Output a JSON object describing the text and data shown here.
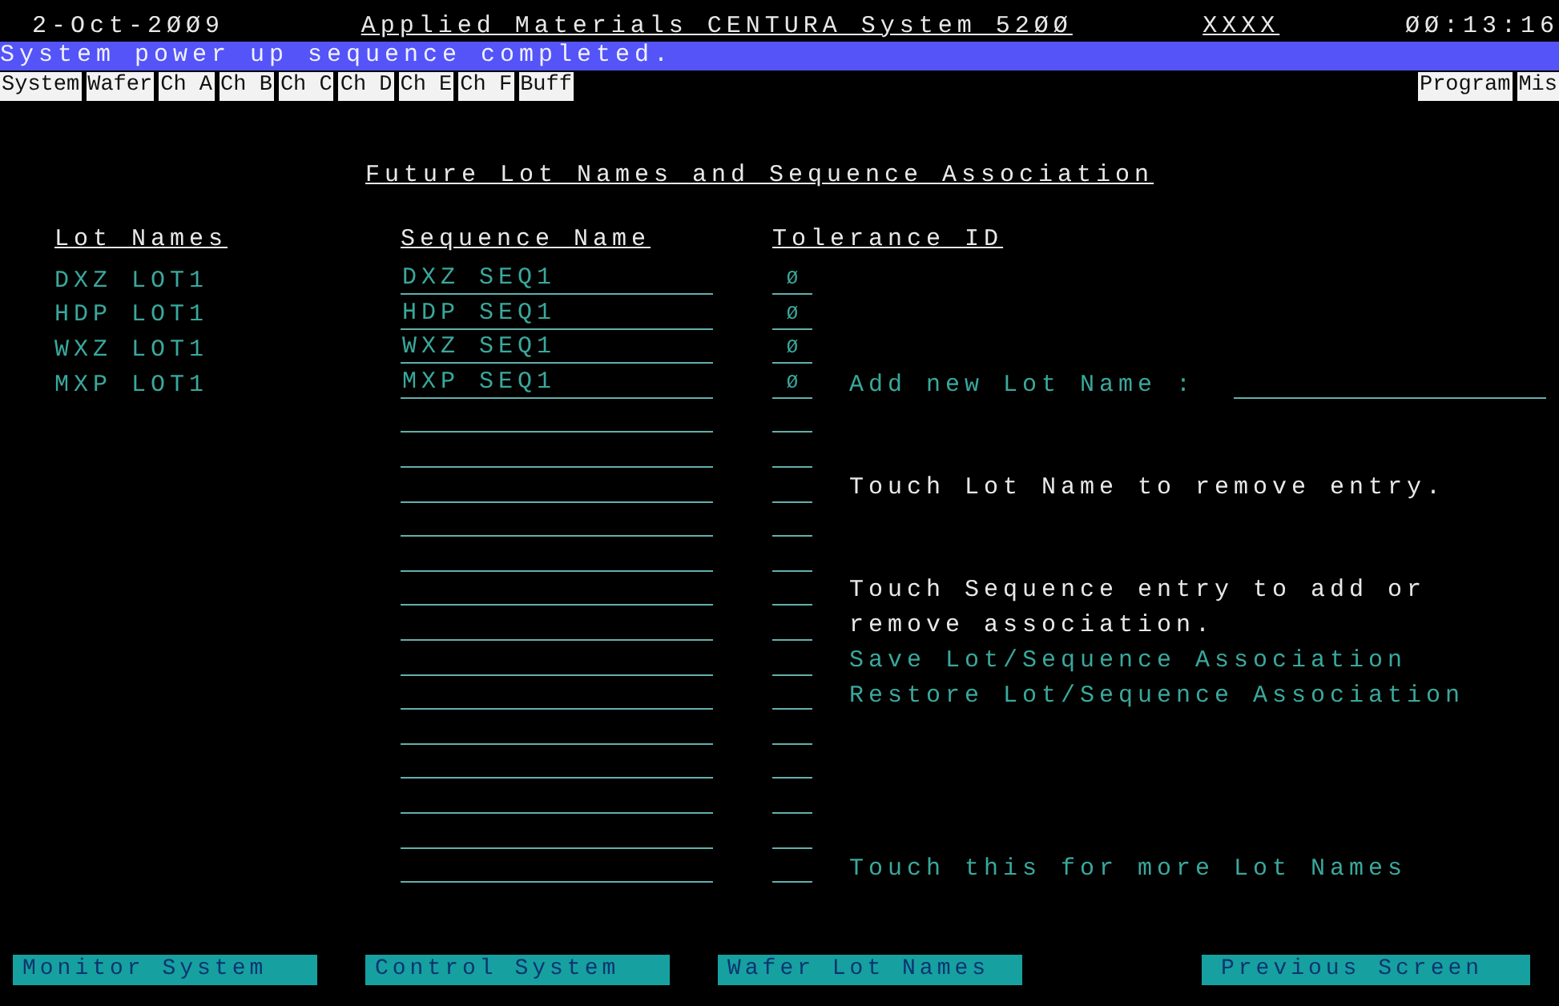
{
  "header": {
    "date": "2-Oct-2ØØ9",
    "title": "Applied Materials CENTURA System",
    "model": "52ØØ",
    "user": "XXXX",
    "time": "ØØ:13:16"
  },
  "message": "System power up sequence completed.",
  "nav_tabs": {
    "left": [
      "System",
      "Wafer",
      "Ch A",
      "Ch B",
      "Ch C",
      "Ch D",
      "Ch E",
      "Ch F",
      "Buff"
    ],
    "right": [
      "Program",
      "Mis"
    ]
  },
  "page_title": "Future Lot Names and Sequence Association",
  "columns": [
    "Lot Names",
    "Sequence Name",
    "Tolerance ID"
  ],
  "rows": [
    {
      "kind": "entry",
      "lot": "DXZ LOT1",
      "sequence": "DXZ SEQ1",
      "tolerance": "Ø"
    },
    {
      "kind": "entry",
      "lot": "HDP LOT1",
      "sequence": "HDP SEQ1",
      "tolerance": "Ø"
    },
    {
      "kind": "entry",
      "lot": "WXZ LOT1",
      "sequence": "WXZ SEQ1",
      "tolerance": "Ø"
    },
    {
      "kind": "entry",
      "lot": "MXP LOT1",
      "sequence": "MXP SEQ1",
      "tolerance": "Ø"
    },
    {
      "kind": "blank"
    },
    {
      "kind": "blank"
    },
    {
      "kind": "blank"
    },
    {
      "kind": "blank"
    },
    {
      "kind": "blank"
    },
    {
      "kind": "blank"
    },
    {
      "kind": "blank"
    },
    {
      "kind": "blank"
    },
    {
      "kind": "blank"
    },
    {
      "kind": "blank"
    },
    {
      "kind": "blank"
    },
    {
      "kind": "blank"
    },
    {
      "kind": "blank"
    },
    {
      "kind": "blank"
    }
  ],
  "add_lot": {
    "label": "Add new Lot Name :"
  },
  "instructions": [
    {
      "kind": "note",
      "text": "Touch Lot Name to remove entry."
    },
    {
      "kind": "note",
      "text": "Touch Sequence entry to add or remove association."
    },
    {
      "kind": "action",
      "text": "Save Lot/Sequence Association"
    },
    {
      "kind": "action",
      "text": "Restore Lot/Sequence Association"
    },
    {
      "kind": "action",
      "text": "Touch this for more Lot Names"
    }
  ],
  "footer_buttons": [
    "Monitor System",
    "Control System",
    "Wafer Lot Names",
    "Previous Screen"
  ]
}
